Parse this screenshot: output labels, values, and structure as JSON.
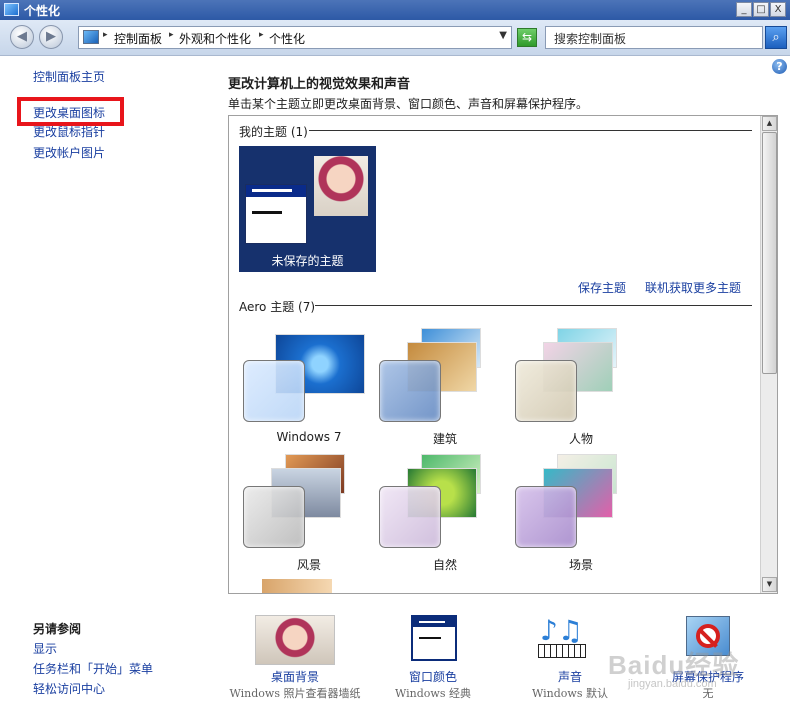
{
  "window": {
    "title": "个性化",
    "minimize": "_",
    "maximize": "□",
    "close": "X"
  },
  "address": {
    "crumbs": [
      "控制面板",
      "外观和个性化",
      "个性化"
    ],
    "search_placeholder": "搜索控制面板"
  },
  "left": {
    "links": [
      "控制面板主页",
      "更改桌面图标",
      "更改鼠标指针",
      "更改帐户图片"
    ],
    "see_also_title": "另请参阅",
    "see_also": [
      "显示",
      "任务栏和「开始」菜单",
      "轻松访问中心"
    ]
  },
  "main": {
    "title": "更改计算机上的视觉效果和声音",
    "description": "单击某个主题立即更改桌面背景、窗口颜色、声音和屏幕保护程序。",
    "my_themes_header": "我的主题 (1)",
    "unsaved_theme": "未保存的主题",
    "save_theme": "保存主题",
    "get_more": "联机获取更多主题",
    "aero_header": "Aero 主题 (7)",
    "themes": [
      "Windows 7",
      "建筑",
      "人物",
      "风景",
      "自然",
      "场景"
    ]
  },
  "bottom": [
    {
      "name": "桌面背景",
      "sub": "Windows 照片查看器墙纸"
    },
    {
      "name": "窗口颜色",
      "sub": "Windows 经典"
    },
    {
      "name": "声音",
      "sub": "Windows 默认"
    },
    {
      "name": "屏幕保护程序",
      "sub": "无"
    }
  ],
  "watermark": {
    "brand": "Baidu经验",
    "url": "jingyan.baidu.com"
  },
  "colors": {
    "highlight": "#e8151b",
    "link": "#1a3fa0",
    "titlebar": "#2d59a6"
  }
}
